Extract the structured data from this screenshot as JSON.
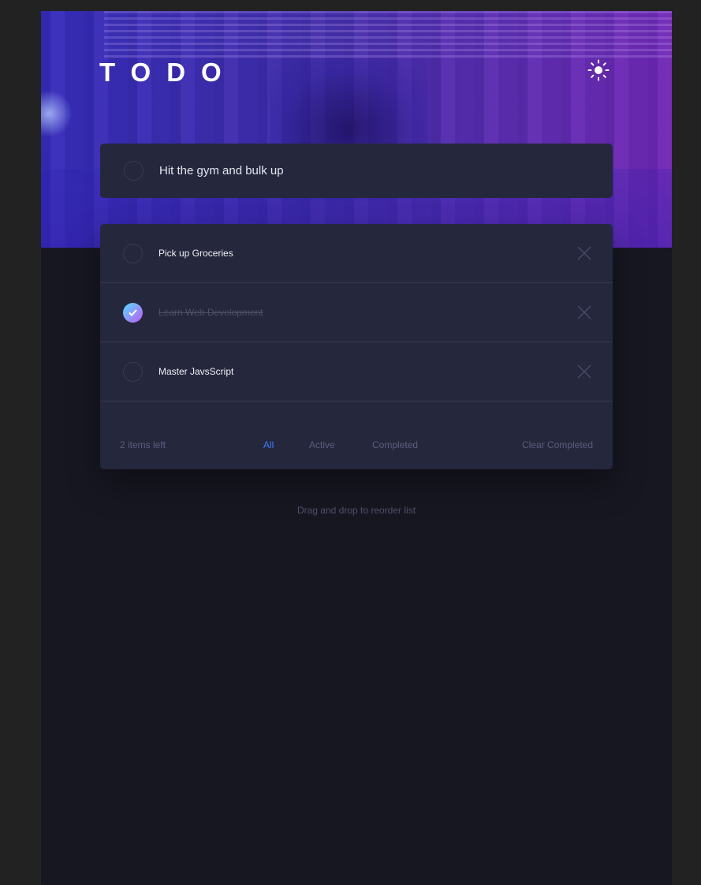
{
  "header": {
    "title": "TODO",
    "theme_icon": "sun-icon"
  },
  "new_todo": {
    "value": "Hit the gym and bulk up"
  },
  "todos": [
    {
      "label": "Pick up Groceries",
      "completed": false
    },
    {
      "label": "Learn Web Development",
      "completed": true
    },
    {
      "label": "Master JavsScript",
      "completed": false
    }
  ],
  "footer": {
    "items_left": "2 items left",
    "filters": [
      "All",
      "Active",
      "Completed"
    ],
    "active_filter": "All",
    "clear_label": "Clear Completed"
  },
  "hint": "Drag and drop to reorder list",
  "colors": {
    "accent": "#3a7cfd",
    "check_gradient_start": "#57ddff",
    "check_gradient_end": "#c058f3",
    "card": "#25273c",
    "background": "#171722"
  }
}
